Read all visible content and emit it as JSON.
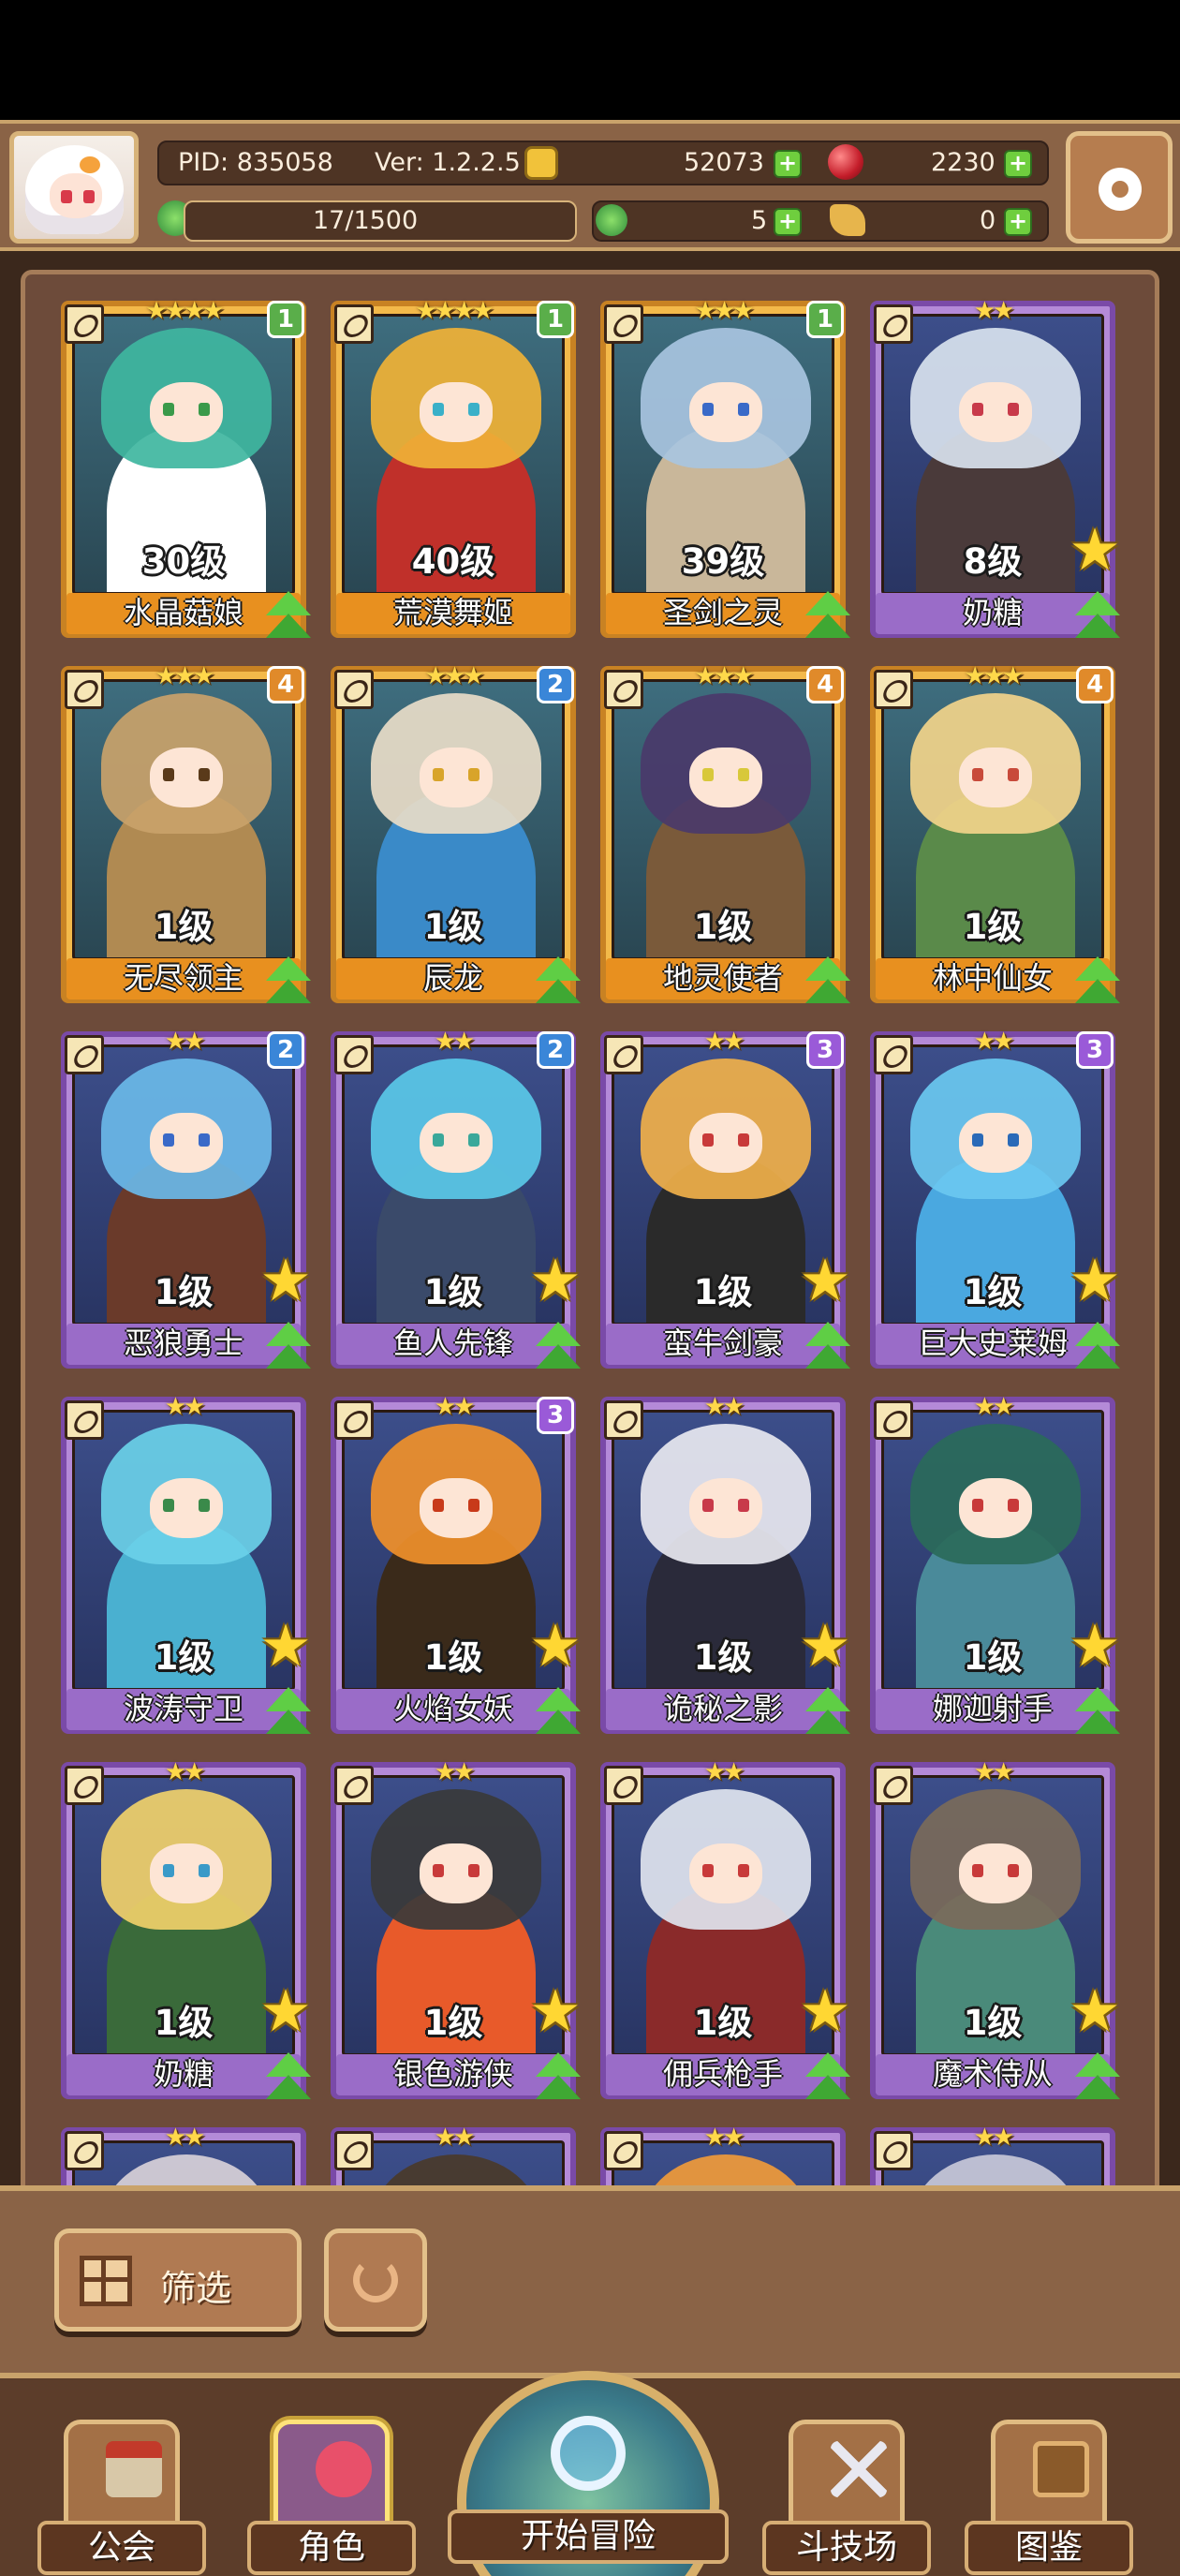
{
  "header": {
    "pid": "PID: 835058",
    "version": "Ver: 1.2.2.5",
    "gold": "52073",
    "gems": "2230",
    "stamina": "17/1500",
    "clover": "5",
    "keys": "0"
  },
  "cards": [
    {
      "name": "水晶菇娘",
      "level": "30级",
      "stars": "★★★★",
      "badge": "1",
      "badge_color": "green",
      "rarity": "gold",
      "hair": "#3fb6a0",
      "body": "#ffffff",
      "eye": "#3a9a4a",
      "upgrade": true,
      "star_badge": false
    },
    {
      "name": "荒漠舞姬",
      "level": "40级",
      "stars": "★★★★",
      "badge": "1",
      "badge_color": "green",
      "rarity": "gold",
      "hair": "#f0b236",
      "body": "#c0302a",
      "eye": "#3ab0c8",
      "upgrade": false,
      "star_badge": false
    },
    {
      "name": "圣剑之灵",
      "level": "39级",
      "stars": "★★★",
      "badge": "1",
      "badge_color": "green",
      "rarity": "gold",
      "hair": "#a8c4e0",
      "body": "#c9b79a",
      "eye": "#3a6ac8",
      "upgrade": true,
      "star_badge": false
    },
    {
      "name": "奶糖",
      "level": "8级",
      "stars": "★★",
      "badge": "",
      "badge_color": "",
      "rarity": "purple",
      "hair": "#d8e2ee",
      "body": "#4a3a3a",
      "eye": "#c83a4a",
      "upgrade": true,
      "star_badge": true
    },
    {
      "name": "无尽领主",
      "level": "1级",
      "stars": "★★★",
      "badge": "4",
      "badge_color": "orange",
      "rarity": "gold",
      "hair": "#c9a26a",
      "body": "#b08a52",
      "eye": "#5a3a1a",
      "upgrade": true,
      "star_badge": false
    },
    {
      "name": "辰龙",
      "level": "1级",
      "stars": "★★★",
      "badge": "2",
      "badge_color": "blue",
      "rarity": "gold",
      "hair": "#e8dcc8",
      "body": "#3a8ac8",
      "eye": "#d8a42a",
      "upgrade": true,
      "star_badge": false
    },
    {
      "name": "地灵使者",
      "level": "1级",
      "stars": "★★★",
      "badge": "4",
      "badge_color": "orange",
      "rarity": "gold",
      "hair": "#4a3a6a",
      "body": "#7a5a3a",
      "eye": "#d8c83a",
      "upgrade": true,
      "star_badge": false
    },
    {
      "name": "林中仙女",
      "level": "1级",
      "stars": "★★★",
      "badge": "4",
      "badge_color": "orange",
      "rarity": "gold",
      "hair": "#f2d48a",
      "body": "#5a8a4a",
      "eye": "#c84a3a",
      "upgrade": true,
      "star_badge": false
    },
    {
      "name": "恶狼勇士",
      "level": "1级",
      "stars": "★★",
      "badge": "2",
      "badge_color": "blue",
      "rarity": "purple",
      "hair": "#6ab8e8",
      "body": "#6a3a2a",
      "eye": "#3a6ac8",
      "upgrade": true,
      "star_badge": true
    },
    {
      "name": "鱼人先锋",
      "level": "1级",
      "stars": "★★",
      "badge": "2",
      "badge_color": "blue",
      "rarity": "purple",
      "hair": "#5ac8e8",
      "body": "#3a4a6a",
      "eye": "#3aa89a",
      "upgrade": true,
      "star_badge": true
    },
    {
      "name": "蛮牛剑豪",
      "level": "1级",
      "stars": "★★",
      "badge": "3",
      "badge_color": "purple",
      "rarity": "purple",
      "hair": "#f0b04a",
      "body": "#2a2a2a",
      "eye": "#c83a3a",
      "upgrade": true,
      "star_badge": true
    },
    {
      "name": "巨大史莱姆",
      "level": "1级",
      "stars": "★★",
      "badge": "3",
      "badge_color": "purple",
      "rarity": "purple",
      "hair": "#6ac8f0",
      "body": "#4aa8e0",
      "eye": "#2a6ab8",
      "upgrade": true,
      "star_badge": true
    },
    {
      "name": "波涛守卫",
      "level": "1级",
      "stars": "★★",
      "badge": "",
      "badge_color": "",
      "rarity": "purple",
      "hair": "#6ad0e8",
      "body": "#4ab0d0",
      "eye": "#3a8a4a",
      "upgrade": true,
      "star_badge": true
    },
    {
      "name": "火焰女妖",
      "level": "1级",
      "stars": "★★",
      "badge": "3",
      "badge_color": "purple",
      "rarity": "purple",
      "hair": "#f0902a",
      "body": "#3a2a1a",
      "eye": "#c83a1a",
      "upgrade": true,
      "star_badge": true
    },
    {
      "name": "诡秘之影",
      "level": "1级",
      "stars": "★★",
      "badge": "",
      "badge_color": "",
      "rarity": "purple",
      "hair": "#e8e8f0",
      "body": "#2a2a3a",
      "eye": "#c83a4a",
      "upgrade": true,
      "star_badge": true
    },
    {
      "name": "娜迦射手",
      "level": "1级",
      "stars": "★★",
      "badge": "",
      "badge_color": "",
      "rarity": "purple",
      "hair": "#2a6a5a",
      "body": "#4a8a9a",
      "eye": "#c83a3a",
      "upgrade": true,
      "star_badge": true
    },
    {
      "name": "奶糖",
      "level": "1级",
      "stars": "★★",
      "badge": "",
      "badge_color": "",
      "rarity": "purple",
      "hair": "#f0d06a",
      "body": "#3a6a3a",
      "eye": "#3a9ac8",
      "upgrade": true,
      "star_badge": true
    },
    {
      "name": "银色游侠",
      "level": "1级",
      "stars": "★★",
      "badge": "",
      "badge_color": "",
      "rarity": "purple",
      "hair": "#3a3a3a",
      "body": "#e85a2a",
      "eye": "#c83a3a",
      "upgrade": true,
      "star_badge": true
    },
    {
      "name": "佣兵枪手",
      "level": "1级",
      "stars": "★★",
      "badge": "",
      "badge_color": "",
      "rarity": "purple",
      "hair": "#e0e4ee",
      "body": "#8a2a2a",
      "eye": "#c83a3a",
      "upgrade": true,
      "star_badge": true
    },
    {
      "name": "魔术侍从",
      "level": "1级",
      "stars": "★★",
      "badge": "",
      "badge_color": "",
      "rarity": "purple",
      "hair": "#7a6a5a",
      "body": "#4a8a7a",
      "eye": "#c83a3a",
      "upgrade": true,
      "star_badge": true
    },
    {
      "name": "",
      "level": "",
      "stars": "★★",
      "badge": "",
      "badge_color": "",
      "rarity": "purple",
      "hair": "#d8d0d8",
      "body": "#6a5a6a",
      "eye": "#c83a3a",
      "upgrade": false,
      "star_badge": false
    },
    {
      "name": "",
      "level": "",
      "stars": "★★",
      "badge": "",
      "badge_color": "",
      "rarity": "purple",
      "hair": "#4a3a2a",
      "body": "#3a2a2a",
      "eye": "#c83a3a",
      "upgrade": false,
      "star_badge": false
    },
    {
      "name": "",
      "level": "",
      "stars": "★★",
      "badge": "",
      "badge_color": "",
      "rarity": "purple",
      "hair": "#f09a3a",
      "body": "#3a2a2a",
      "eye": "#c83a3a",
      "upgrade": false,
      "star_badge": false
    },
    {
      "name": "",
      "level": "",
      "stars": "★★",
      "badge": "",
      "badge_color": "",
      "rarity": "purple",
      "hair": "#c8c8d8",
      "body": "#3a3a5a",
      "eye": "#c83a3a",
      "upgrade": false,
      "star_badge": false
    }
  ],
  "actions": {
    "filter_label": "筛选"
  },
  "nav": {
    "guild": "公会",
    "character": "角色",
    "start": "开始冒险",
    "arena": "斗技场",
    "codex": "图鉴"
  }
}
